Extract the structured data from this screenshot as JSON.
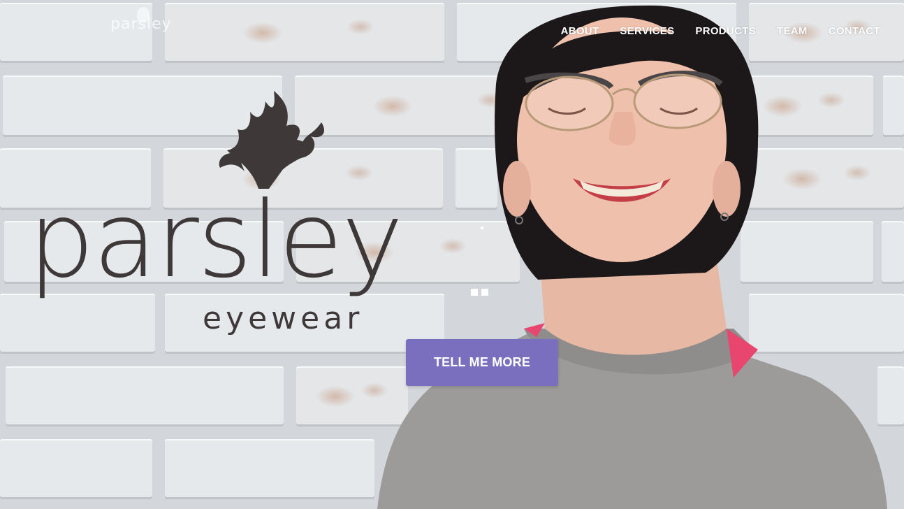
{
  "site": {
    "nav_logo_text": "parsley",
    "brand_wordmark": "parsley",
    "brand_tagline": "eyewear"
  },
  "nav": {
    "items": [
      {
        "label": "ABOUT"
      },
      {
        "label": "SERVICES"
      },
      {
        "label": "PRODUCTS"
      },
      {
        "label": "TEAM"
      },
      {
        "label": "CONTACT"
      }
    ]
  },
  "hero": {
    "cta_label": "TELL ME MORE",
    "accent_color": "#7a6fbf",
    "logo_color": "#3e3839",
    "image_description_icon": "smiling-person-photo"
  }
}
